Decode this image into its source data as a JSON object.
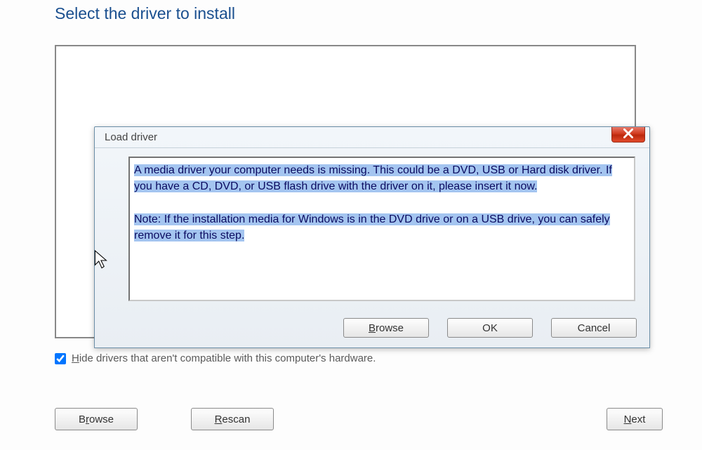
{
  "page": {
    "title": "Select the driver to install",
    "hide_checkbox_label_pre": "H",
    "hide_checkbox_label_rest": "ide drivers that aren't compatible with this computer's hardware."
  },
  "mainButtons": {
    "browse_pre": "B",
    "browse_u": "r",
    "browse_post": "owse",
    "rescan_pre": "",
    "rescan_u": "R",
    "rescan_post": "escan",
    "next_pre": "",
    "next_u": "N",
    "next_post": "ext"
  },
  "dialog": {
    "title": "Load driver",
    "para1": "A media driver your computer needs is missing. This could be a DVD, USB or Hard disk driver. If you have a CD, DVD, or USB flash drive with the driver on it, please insert it now.",
    "para2": "Note: If the installation media for Windows is in the DVD drive or on a USB drive, you can safely remove it for this step.",
    "browse_pre": "",
    "browse_u": "B",
    "browse_post": "rowse",
    "ok": "OK",
    "cancel": "Cancel"
  }
}
